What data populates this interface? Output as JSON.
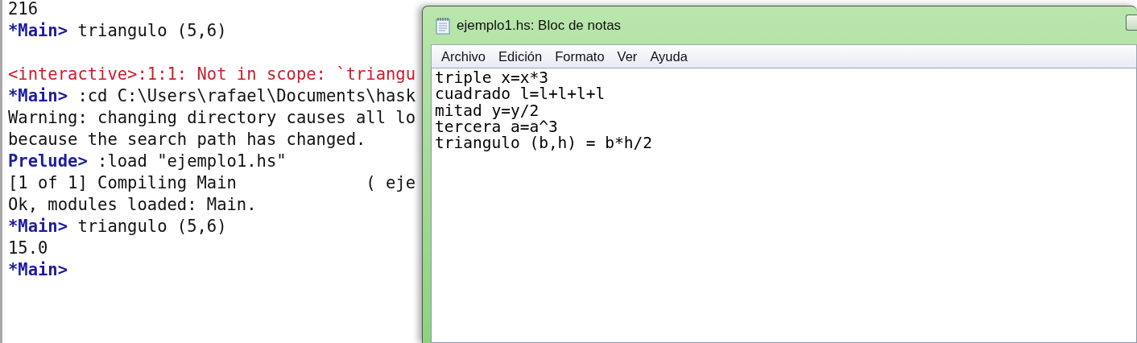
{
  "console": {
    "lines": [
      {
        "kind": "text",
        "segments": [
          {
            "kind": "output",
            "text": "216"
          }
        ]
      },
      {
        "kind": "text",
        "segments": [
          {
            "kind": "prompt",
            "text": "*Main>"
          },
          {
            "kind": "output",
            "text": " triangulo (5,6)"
          }
        ]
      },
      {
        "kind": "blank"
      },
      {
        "kind": "text",
        "segments": [
          {
            "kind": "error",
            "text": "<interactive>:1:1: Not in scope: `triangu"
          }
        ]
      },
      {
        "kind": "text",
        "segments": [
          {
            "kind": "prompt",
            "text": "*Main>"
          },
          {
            "kind": "output",
            "text": " :cd C:\\Users\\rafael\\Documents\\hask"
          }
        ]
      },
      {
        "kind": "text",
        "segments": [
          {
            "kind": "output",
            "text": "Warning: changing directory causes all lo"
          }
        ]
      },
      {
        "kind": "text",
        "segments": [
          {
            "kind": "output",
            "text": "because the search path has changed."
          }
        ]
      },
      {
        "kind": "text",
        "segments": [
          {
            "kind": "prompt",
            "text": "Prelude>"
          },
          {
            "kind": "output",
            "text": " :load \"ejemplo1.hs\""
          }
        ]
      },
      {
        "kind": "text",
        "segments": [
          {
            "kind": "output",
            "text": "[1 of 1] Compiling Main             ( eje"
          }
        ]
      },
      {
        "kind": "text",
        "segments": [
          {
            "kind": "output",
            "text": "Ok, modules loaded: Main."
          }
        ]
      },
      {
        "kind": "text",
        "segments": [
          {
            "kind": "prompt",
            "text": "*Main>"
          },
          {
            "kind": "output",
            "text": " triangulo (5,6)"
          }
        ]
      },
      {
        "kind": "text",
        "segments": [
          {
            "kind": "output",
            "text": "15.0"
          }
        ]
      },
      {
        "kind": "text",
        "segments": [
          {
            "kind": "prompt",
            "text": "*Main>"
          }
        ]
      }
    ]
  },
  "notepad": {
    "title": "ejemplo1.hs: Bloc de notas",
    "menu": [
      "Archivo",
      "Edición",
      "Formato",
      "Ver",
      "Ayuda"
    ],
    "content": [
      "triple x=x*3",
      "cuadrado l=l+l+l+l",
      "mitad y=y/2",
      "tercera a=a^3",
      "triangulo (b,h) = b*h/2"
    ]
  }
}
